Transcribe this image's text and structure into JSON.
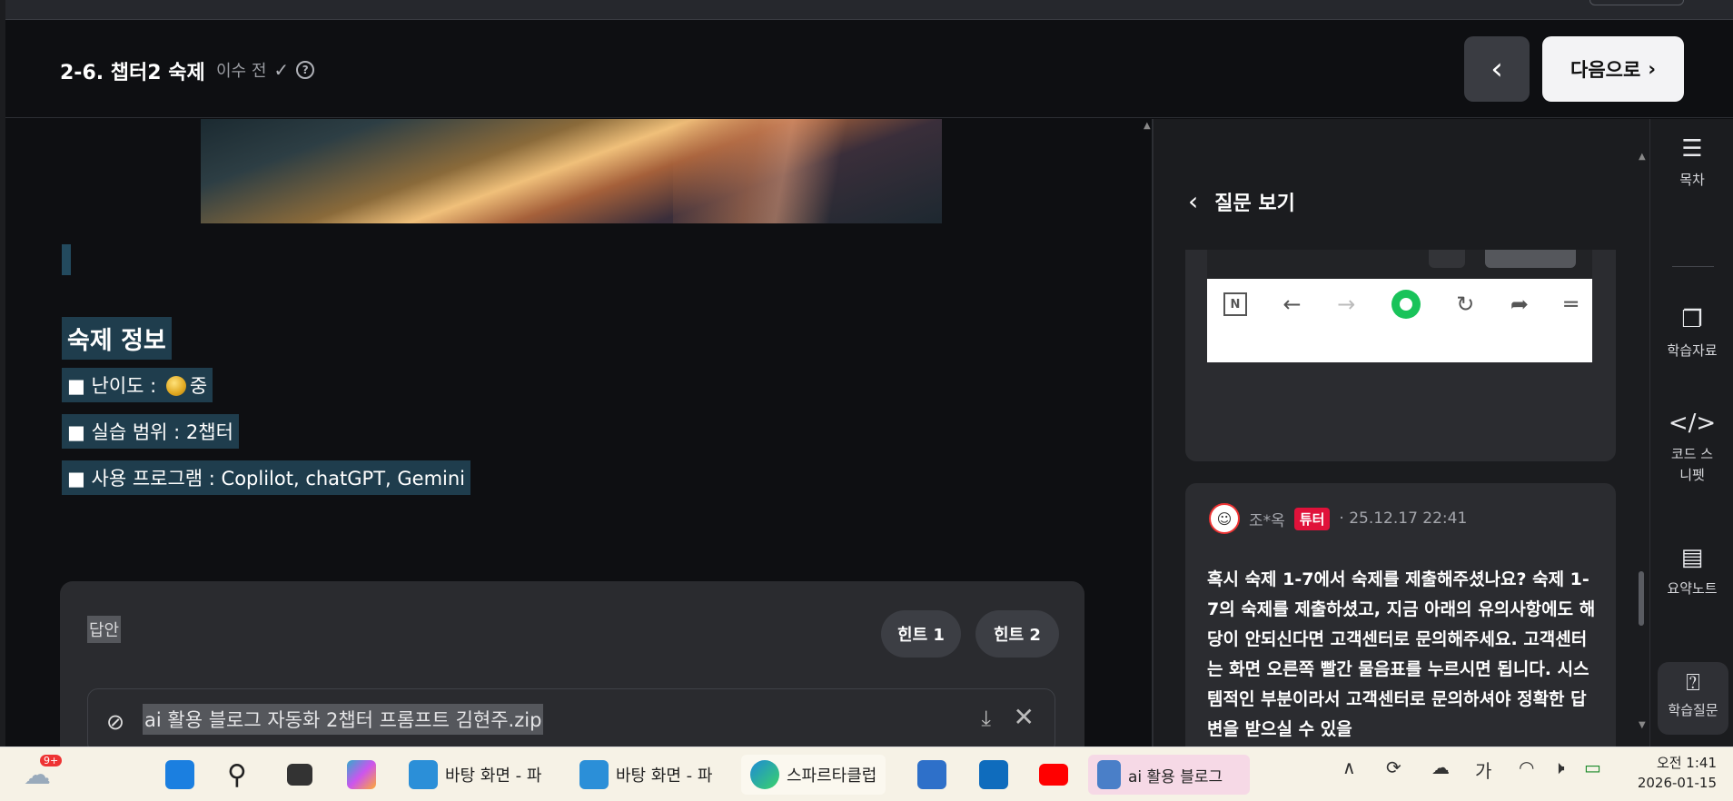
{
  "header": {
    "title": "2-6. 챕터2 숙제",
    "status": "이수 전",
    "next_label": "다음으로"
  },
  "content": {
    "info_title": "숙제 정보",
    "difficulty": "■ 난이도 :",
    "difficulty_value": "중",
    "scope": "■ 실습 범위 : 2챕터",
    "programs": "■ 사용 프로그램  : Coplilot, chatGPT, Gemini"
  },
  "answer": {
    "label": "답안",
    "hint1": "힌트 1",
    "hint2": "힌트 2",
    "file_name": "ai 활용 블로그 자동화 2챕터 프롬프트 김현주.zip"
  },
  "question_panel": {
    "title": "질문 보기",
    "author": "조*옥",
    "badge": "튜터",
    "datetime": "· 25.12.17 22:41",
    "text": "혹시 숙제 1-7에서 숙제를 제출해주셨나요? 숙제 1-7의 숙제를 제출하셨고, 지금 아래의 유의사항에도 해당이 안되신다면 고객센터로 문의해주세요. 고객센터는 화면 오른쪽 빨간 물음표를 누르시면 됩니다. 시스템적인 부분이라서 고객센터로 문의하셔야 정확한 답변을 받으실 수 있을"
  },
  "rail": {
    "items": [
      "목차",
      "학습자료",
      "코드 스니펫",
      "요약노트",
      "학습질문"
    ]
  },
  "taskbar": {
    "notification_badge": "9+",
    "apps": [
      "바탕 화면 - 파",
      "바탕 화면 - 파",
      "스파르타클럽",
      "ai 활용 블로그"
    ],
    "ime": "가",
    "time": "오전 1:41",
    "date": "2026-01-15"
  },
  "colors": {
    "accent_red": "#e0123a",
    "green": "#19c35a",
    "highlight": "#1f3d4d"
  }
}
